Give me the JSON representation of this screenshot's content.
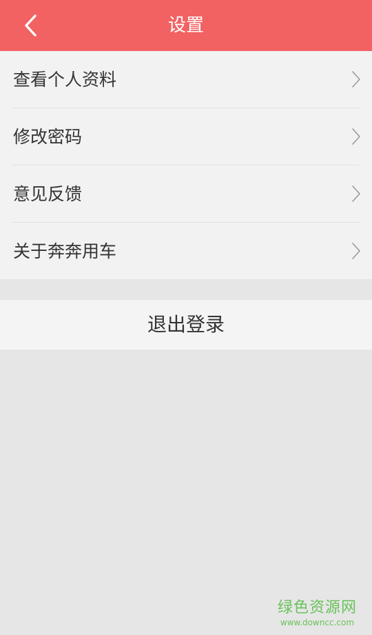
{
  "header": {
    "title": "设置",
    "back_icon": "chevron-left-icon",
    "bg_color": "#f26263"
  },
  "menu": {
    "items": [
      {
        "label": "查看个人资料",
        "icon": "chevron-right-icon"
      },
      {
        "label": "修改密码",
        "icon": "chevron-right-icon"
      },
      {
        "label": "意见反馈",
        "icon": "chevron-right-icon"
      },
      {
        "label": "关于奔奔用车",
        "icon": "chevron-right-icon"
      }
    ]
  },
  "logout": {
    "label": "退出登录"
  },
  "watermark": {
    "title": "绿色资源网",
    "url": "www.downcc.com",
    "color": "#69c25a"
  }
}
